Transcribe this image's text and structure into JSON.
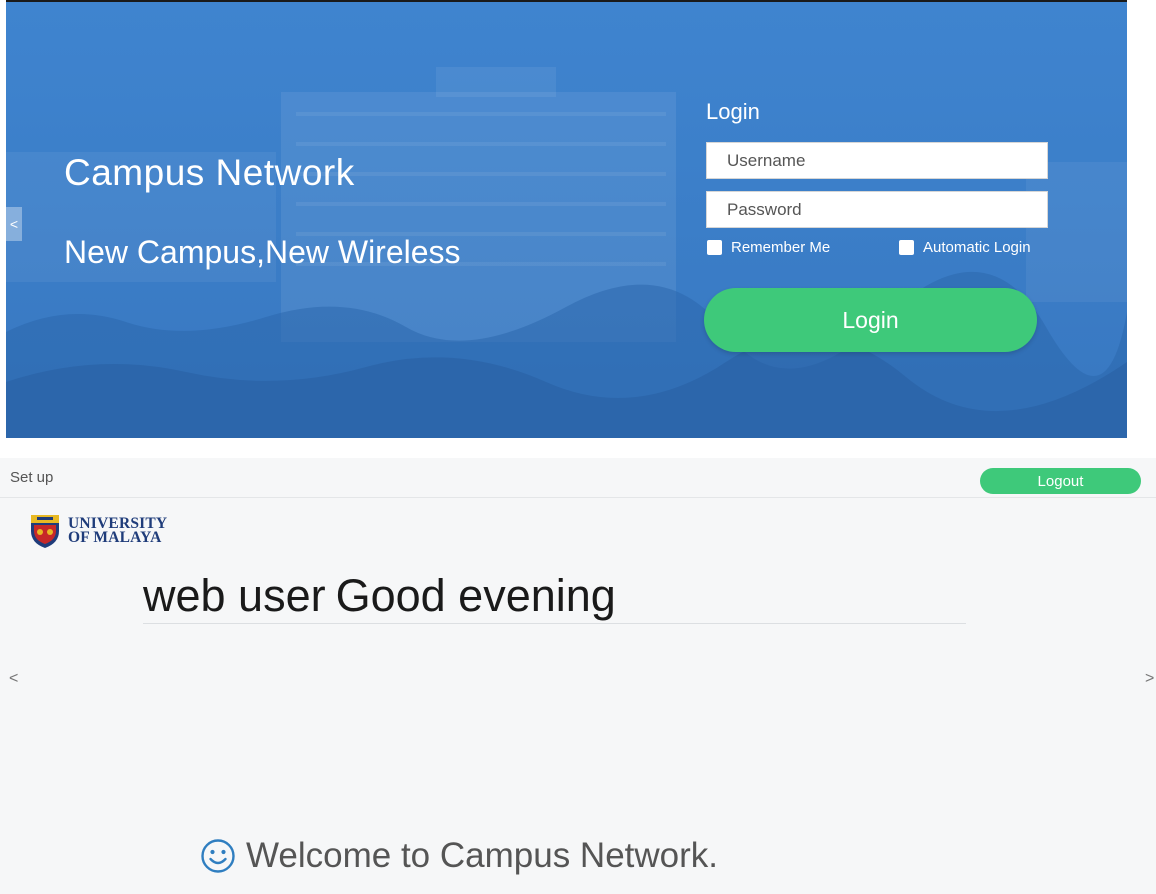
{
  "login_screen": {
    "hero_title": "Campus Network",
    "hero_subtitle": "New Campus,New Wireless",
    "login_heading": "Login",
    "username_placeholder": "Username",
    "password_placeholder": "Password",
    "remember_label": "Remember Me",
    "auto_login_label": "Automatic Login",
    "login_button": "Login",
    "prev_arrow": "<"
  },
  "portal": {
    "setup_label": "Set up",
    "logout_label": "Logout",
    "logo_line1": "UNIVERSITY",
    "logo_line2": "OF MALAYA",
    "greeting_user": "web user",
    "greeting_text": "Good evening",
    "prev_arrow": "<",
    "next_arrow": ">",
    "welcome_text": "Welcome to Campus Network."
  },
  "colors": {
    "login_bg": "#3b7ec8",
    "accent_green": "#3ec97a",
    "portal_bg": "#f6f7f8",
    "logo_blue": "#1f3c7a"
  },
  "icons": [
    "chevron-left-icon",
    "chevron-right-icon",
    "checkbox-icon",
    "university-crest-icon",
    "smile-icon"
  ]
}
